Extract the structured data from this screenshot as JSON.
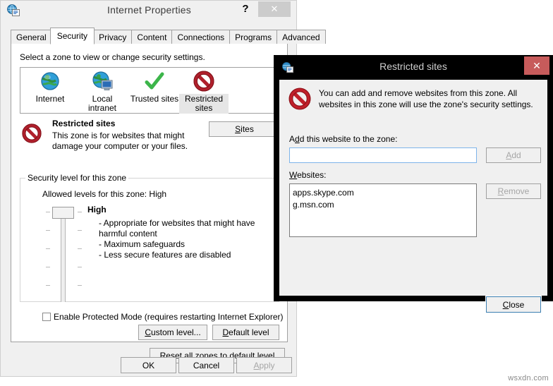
{
  "ie_window": {
    "title": "Internet Properties",
    "icon": "internet-properties-icon",
    "help_label": "?",
    "close_label": "✕",
    "tabs": [
      {
        "label": "General",
        "active": false
      },
      {
        "label": "Security",
        "active": true
      },
      {
        "label": "Privacy",
        "active": false
      },
      {
        "label": "Content",
        "active": false
      },
      {
        "label": "Connections",
        "active": false
      },
      {
        "label": "Programs",
        "active": false
      },
      {
        "label": "Advanced",
        "active": false
      }
    ],
    "security_tab": {
      "zone_hint": "Select a zone to view or change security settings.",
      "zones": [
        {
          "label": "Internet",
          "icon": "globe-icon",
          "selected": false
        },
        {
          "label": "Local intranet",
          "icon": "globe-computer-icon",
          "selected": false
        },
        {
          "label": "Trusted sites",
          "icon": "green-check-icon",
          "selected": false
        },
        {
          "label": "Restricted sites",
          "icon": "red-prohibition-icon",
          "selected": true
        }
      ],
      "zone_desc_title": "Restricted sites",
      "zone_desc_body": "This zone is for websites that might damage your computer or your files.",
      "sites_button": "Sites",
      "group_title": "Security level for this zone",
      "allowed_levels": "Allowed levels for this zone: High",
      "level_name": "High",
      "level_bullets": [
        "- Appropriate for websites that might have harmful content",
        "- Maximum safeguards",
        "- Less secure features are disabled"
      ],
      "protected_mode_label": "Enable Protected Mode (requires restarting Internet Explorer)",
      "protected_mode_checked": false,
      "custom_level_button": "Custom level...",
      "default_level_button": "Default level",
      "reset_button": "Reset all zones to default level"
    },
    "footer": {
      "ok": "OK",
      "cancel": "Cancel",
      "apply": "Apply",
      "apply_disabled": true
    }
  },
  "restricted_dialog": {
    "title": "Restricted sites",
    "icon": "internet-properties-icon",
    "close_label": "✕",
    "warning_icon": "red-prohibition-icon",
    "warning_text": "You can add and remove websites from this zone. All websites in this zone will use the zone's security settings.",
    "add_label": "Add this website to the zone:",
    "add_input_value": "",
    "add_input_placeholder": "",
    "add_button": "Add",
    "add_button_disabled": true,
    "websites_label": "Websites:",
    "websites": [
      "apps.skype.com",
      "g.msn.com"
    ],
    "remove_button": "Remove",
    "remove_button_disabled": true,
    "close_button": "Close"
  },
  "watermark": "wsxdn.com",
  "colors": {
    "dialog_titlebar": "#000000",
    "close_red": "#c75b5b",
    "window_chrome": "#f0f0f0",
    "focus_blue": "#3c7fb1",
    "restricted_red": "#c0202a"
  }
}
